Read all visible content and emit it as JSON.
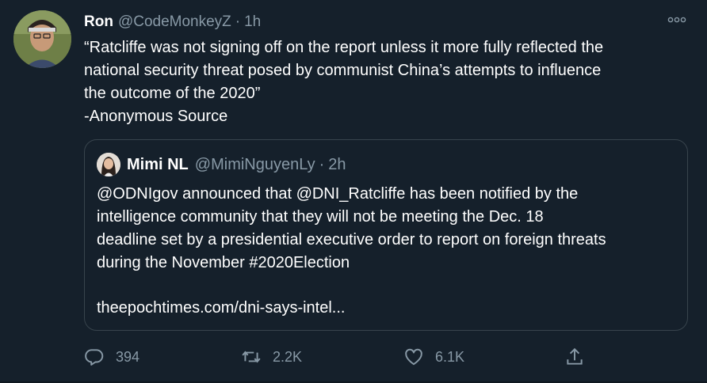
{
  "tweet": {
    "name": "Ron",
    "handle": "@CodeMonkeyZ",
    "separator": "·",
    "time": "1h",
    "text": "“Ratcliffe was not signing off on the report unless it more fully reflected the\nnational security threat posed by communist China’s attempts to influence\nthe outcome of the 2020”\n-Anonymous Source"
  },
  "quote": {
    "name": "Mimi NL",
    "handle": "@MimiNguyenLy",
    "separator": "·",
    "time": "2h",
    "text": "@ODNIgov announced that @DNI_Ratcliffe has been notified by the\nintelligence community that they will not be meeting the Dec. 18\ndeadline set by a presidential executive order to report on foreign threats\nduring the November #2020Election",
    "link": "theepochtimes.com/dni-says-intel..."
  },
  "actions": {
    "reply_count": "394",
    "retweet_count": "2.2K",
    "like_count": "6.1K"
  },
  "colors": {
    "background": "#15202b",
    "secondary_text": "#8899a6",
    "border": "#38444d"
  },
  "icons": {
    "more": "more-icon",
    "reply": "reply-icon",
    "retweet": "retweet-icon",
    "like": "heart-icon",
    "share": "share-icon"
  }
}
